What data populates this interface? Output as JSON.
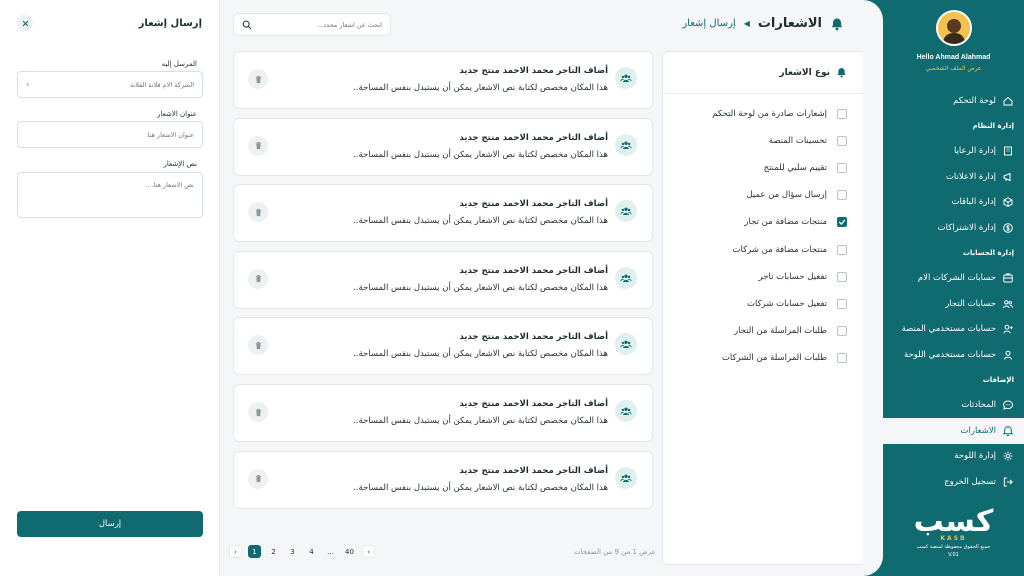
{
  "header": {
    "title": "الاشعارات",
    "crumb": "إرسال إشعار",
    "search_placeholder": "ابحث عن اشعار محدد..."
  },
  "profile": {
    "name": "Hello Ahmad Alahmad",
    "link": "عرض الملف الشخصي"
  },
  "sidebar": {
    "items": [
      {
        "type": "item",
        "label": "لوحة التحكم",
        "icon": "home-icon"
      },
      {
        "type": "section",
        "label": "إدارة النظام"
      },
      {
        "type": "item",
        "label": "إدارة الرعايا",
        "icon": "building-icon"
      },
      {
        "type": "item",
        "label": "إدارة الاعلانات",
        "icon": "megaphone-icon"
      },
      {
        "type": "item",
        "label": "إدارة الباقات",
        "icon": "package-icon"
      },
      {
        "type": "item",
        "label": "إدارة الاشتراكات",
        "icon": "dollar-icon"
      },
      {
        "type": "section",
        "label": "إدارة الحسابات"
      },
      {
        "type": "item",
        "label": "حسابات الشركات الام",
        "icon": "company-icon"
      },
      {
        "type": "item",
        "label": "حسابات التجار",
        "icon": "users-icon"
      },
      {
        "type": "item",
        "label": "حسابات مستخدمي المنصة",
        "icon": "user-add-icon"
      },
      {
        "type": "item",
        "label": "حسابات مستخدمي اللوحة",
        "icon": "user-icon"
      },
      {
        "type": "section",
        "label": "الإضافات"
      },
      {
        "type": "item",
        "label": "المحادثات",
        "icon": "chat-icon"
      },
      {
        "type": "item",
        "label": "الاشعارات",
        "icon": "bell-icon",
        "active": true
      },
      {
        "type": "item",
        "label": "إدارة اللوحة",
        "icon": "gear-icon"
      },
      {
        "type": "item",
        "label": "تسجيل الخروج",
        "icon": "logout-icon"
      }
    ]
  },
  "brand": {
    "logo": "كسب",
    "sub": "KASB",
    "rights": "جميع الحقوق محفوظة لمنصة كسب",
    "version": "V.01"
  },
  "filter": {
    "title": "نوع الاشعار",
    "options": [
      {
        "label": "إشعارات صادرة من لوحة التحكم",
        "checked": false
      },
      {
        "label": "تحسينات المنصة",
        "checked": false
      },
      {
        "label": "تقييم سلبي للمنتج",
        "checked": false
      },
      {
        "label": "إرسال سؤال من عميل",
        "checked": false
      },
      {
        "label": "منتجات مضافة من تجار",
        "checked": true
      },
      {
        "label": "منتجات مضافة من شركات",
        "checked": false
      },
      {
        "label": "تفعيل حسابات تاجر",
        "checked": false
      },
      {
        "label": "تفعيل حسابات شركات",
        "checked": false
      },
      {
        "label": "طلبات المراسلة من التجار",
        "checked": false
      },
      {
        "label": "طلبات المراسلة من الشركات",
        "checked": false
      }
    ]
  },
  "notifications": [
    {
      "title": "أضاف التاجر محمد الاحمد منتج جديد",
      "body": "هذا المكان مخصص لكتابة نص الاشعار يمكن أن يستبدل بنفس المساحة.."
    },
    {
      "title": "أضاف التاجر محمد الاحمد منتج جديد",
      "body": "هذا المكان مخصص لكتابة نص الاشعار يمكن أن يستبدل بنفس المساحة.."
    },
    {
      "title": "أضاف التاجر محمد الاحمد منتج جديد",
      "body": "هذا المكان مخصص لكتابة نص الاشعار يمكن أن يستبدل بنفس المساحة.."
    },
    {
      "title": "أضاف التاجر محمد الاحمد منتج جديد",
      "body": "هذا المكان مخصص لكتابة نص الاشعار يمكن أن يستبدل بنفس المساحة.."
    },
    {
      "title": "أضاف التاجر محمد الاحمد منتج جديد",
      "body": "هذا المكان مخصص لكتابة نص الاشعار يمكن أن يستبدل بنفس المساحة.."
    },
    {
      "title": "أضاف التاجر محمد الاحمد منتج جديد",
      "body": "هذا المكان مخصص لكتابة نص الاشعار يمكن أن يستبدل بنفس المساحة.."
    },
    {
      "title": "أضاف التاجر محمد الاحمد منتج جديد",
      "body": "هذا المكان مخصص لكتابة نص الاشعار يمكن أن يستبدل بنفس المساحة.."
    }
  ],
  "pagination": {
    "info": "عرض 1 من 9 من الصفحات",
    "pages": [
      "1",
      "2",
      "3",
      "4",
      "...",
      "40"
    ],
    "current": "1",
    "prev": "‹",
    "next": "›"
  },
  "compose": {
    "title": "إرسال إشعار",
    "recipient_label": "المرسل إليه",
    "recipient_value": "الشركة الام فلانة الفلانة",
    "subject_label": "عنوان الاشعار",
    "subject_placeholder": "عنوان الاشعار هنا",
    "body_label": "نص الإشعار",
    "body_placeholder": "نص الاشعار هنا....",
    "send_label": "إرسال"
  },
  "colors": {
    "primary": "#0f6b6f",
    "accent": "#f2c14e",
    "background": "#f4f6f7"
  }
}
